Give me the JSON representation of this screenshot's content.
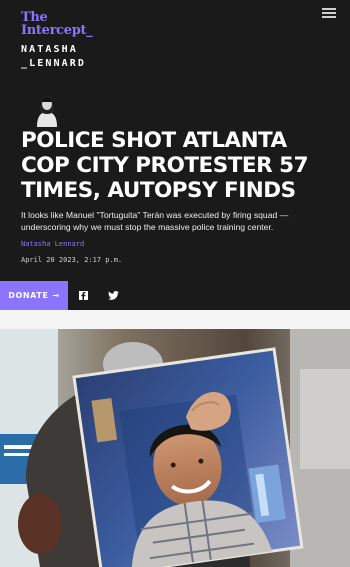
{
  "brand": {
    "logo_line1": "The",
    "logo_line2": "Intercept_"
  },
  "column": {
    "name_line1": "NATASHA",
    "name_line2": "_LENNARD"
  },
  "article": {
    "headline": "POLICE SHOT ATLANTA COP CITY PROTESTER 57 TIMES, AUTOPSY FINDS",
    "dek": "It looks like Manuel \"Tortuguita\" Terán was executed by firing squad — underscoring why we must stop the massive police training center.",
    "author": "Natasha Lennard",
    "date": "April 20 2023, 2:17 p.m."
  },
  "actions": {
    "donate_label": "DONATE",
    "donate_arrow": "→"
  },
  "icons": [
    "menu-icon",
    "facebook-icon",
    "twitter-icon",
    "arrow-right-icon"
  ],
  "colors": {
    "accent": "#8b74ff",
    "background": "#1a1a1a",
    "text": "#ffffff"
  }
}
